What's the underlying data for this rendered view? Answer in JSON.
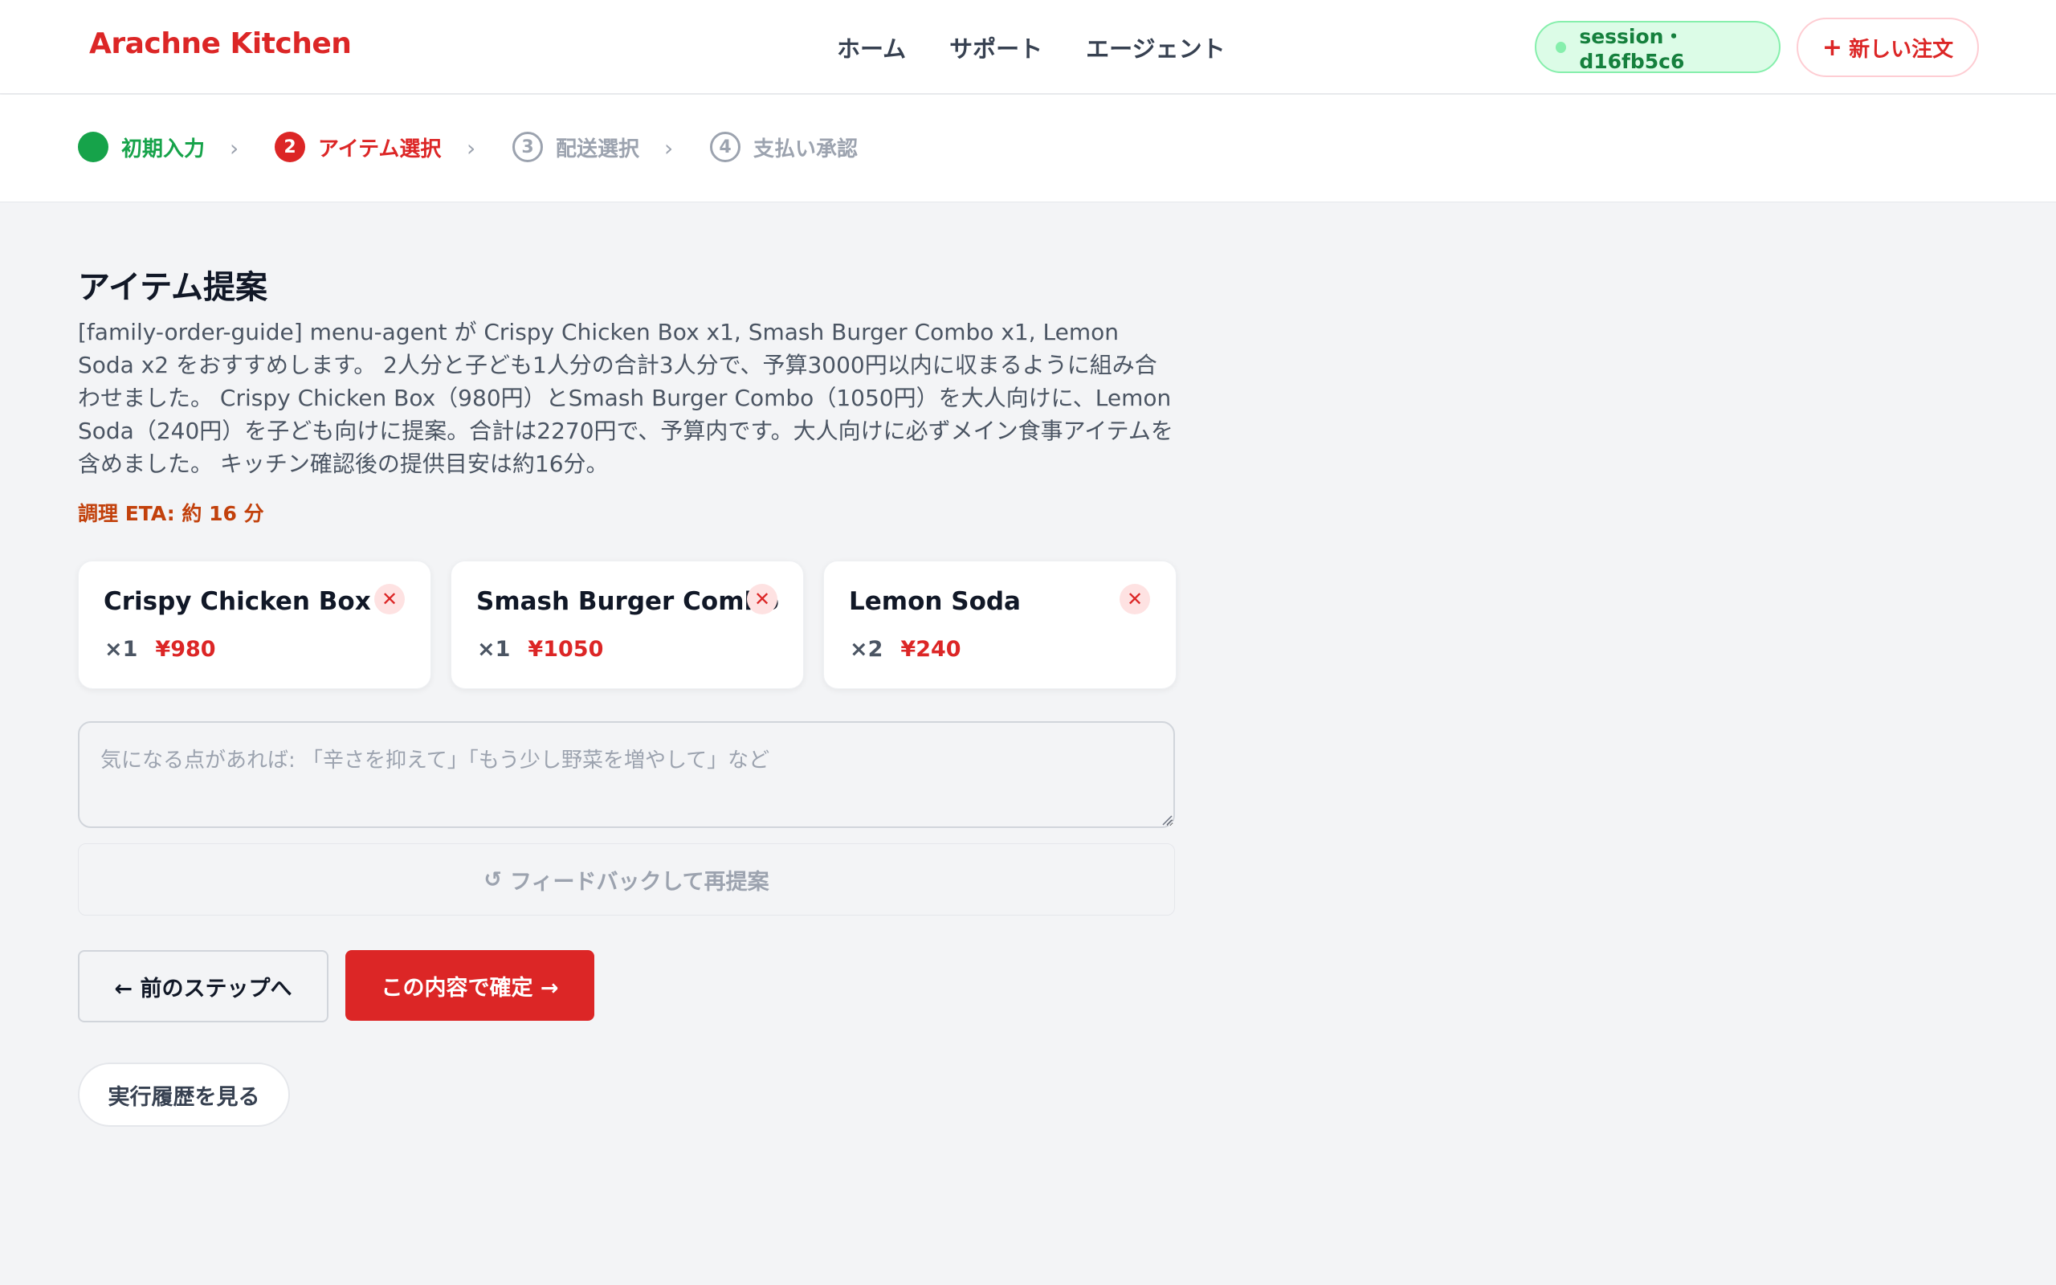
{
  "header": {
    "brand": "Arachne Kitchen",
    "nav": [
      "ホーム",
      "サポート",
      "エージェント"
    ],
    "session_label": "session・d16fb5c6",
    "new_order_label": "新しい注文",
    "new_order_icon": "plus-icon"
  },
  "stepper": {
    "steps": [
      {
        "number": "",
        "label": "初期入力",
        "status": "done"
      },
      {
        "number": "2",
        "label": "アイテム選択",
        "status": "active"
      },
      {
        "number": "3",
        "label": "配送選択",
        "status": "todo"
      },
      {
        "number": "4",
        "label": "支払い承認",
        "status": "todo"
      }
    ],
    "separator": "›"
  },
  "main": {
    "title": "アイテム提案",
    "description": "[family-order-guide] menu-agent が Crispy Chicken Box x1, Smash Burger Combo x1, Lemon Soda x2 をおすすめします。 2人分と子ども1人分の合計3人分で、予算3000円以内に収まるように組み合わせました。 Crispy Chicken Box（980円）とSmash Burger Combo（1050円）を大人向けに、Lemon Soda（240円）を子ども向けに提案。合計は2270円で、予算内です。大人向けに必ずメイン食事アイテムを含めました。 キッチン確認後の提供目安は約16分。",
    "eta": "調理 ETA: 約 16 分",
    "items": [
      {
        "name": "Crispy Chicken Box",
        "qty": "×1",
        "price": "¥980"
      },
      {
        "name": "Smash Burger Combo",
        "qty": "×1",
        "price": "¥1050"
      },
      {
        "name": "Lemon Soda",
        "qty": "×2",
        "price": "¥240"
      }
    ],
    "remove_icon": "close-icon",
    "feedback_placeholder": "気になる点があれば: 「辛さを抑えて」「もう少し野菜を増やして」など",
    "feedback_value": "",
    "repropose_label": "フィードバックして再提案",
    "repropose_icon": "↺",
    "prev_label": "← 前のステップへ",
    "confirm_label": "この内容で確定 →",
    "history_label": "実行履歴を見る"
  },
  "colors": {
    "accent": "#dc2626",
    "success": "#16a34a",
    "eta": "#c2410c",
    "background": "#f3f4f6"
  }
}
